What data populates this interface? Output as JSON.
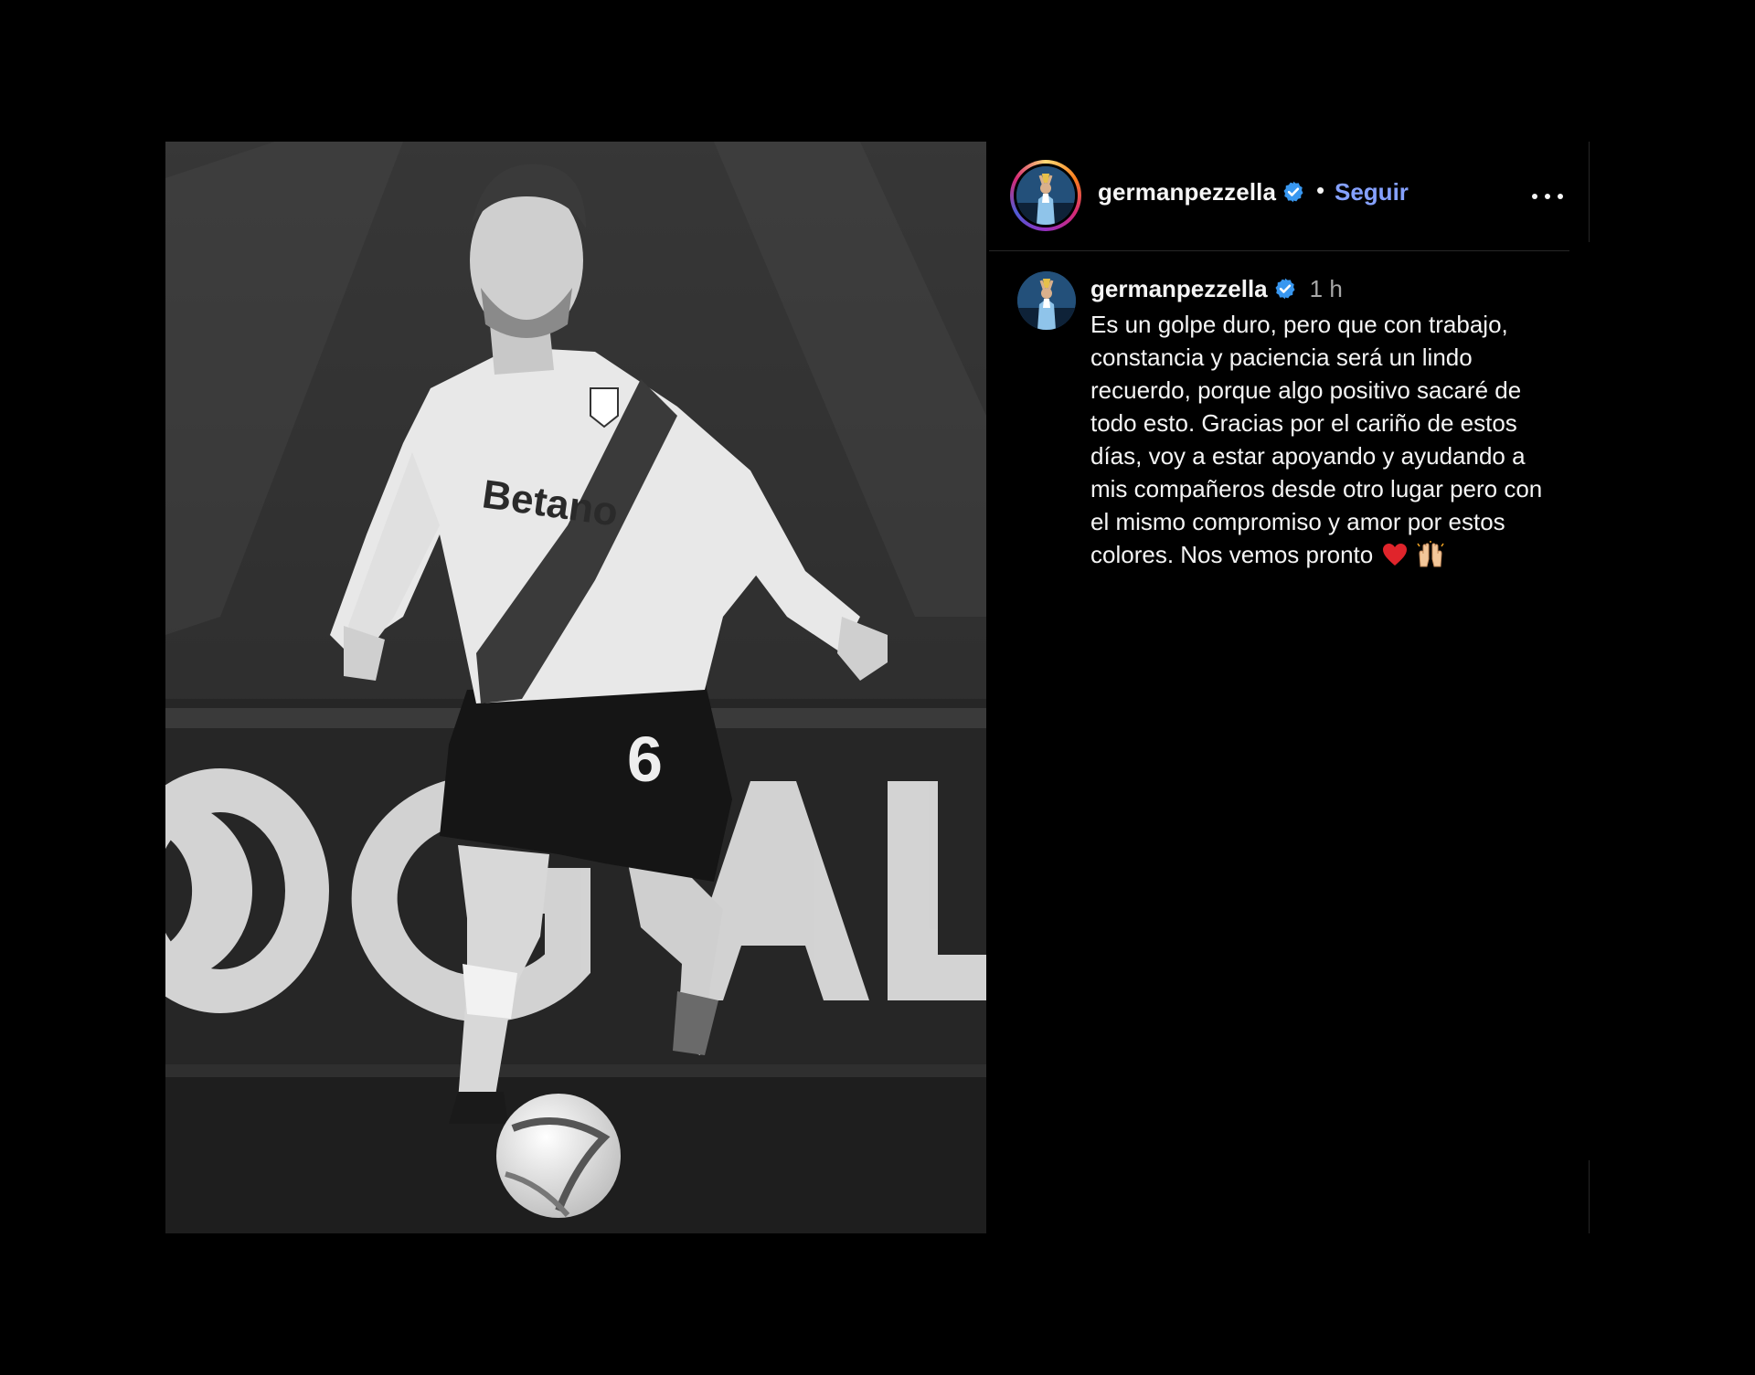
{
  "post": {
    "image_alt": "",
    "photo_colors": {
      "tone": "#2b2b2b",
      "shirt": "#e8e8e8",
      "sash": "#3a3a3a"
    }
  },
  "header": {
    "username": "germanpezzella",
    "separator": "•",
    "follow_label": "Seguir",
    "more_icon": "more-horizontal-icon",
    "verified_icon": "verified-badge-icon"
  },
  "caption": {
    "username": "germanpezzella",
    "time": "1 h",
    "text": "Es un golpe duro, pero que con trabajo, constancia y paciencia será un lindo recuerdo, porque algo positivo sacaré de todo esto. Gracias por el cariño de estos días, voy a estar apoyando y ayudando a mis compañeros desde otro lugar pero con el mismo compromiso y amor por estos colores. Nos vemos pronto",
    "emojis": [
      "red-heart-icon",
      "raising-hands-icon"
    ]
  },
  "colors": {
    "background": "#000000",
    "text": "#f5f5f5",
    "muted": "#a8a8a8",
    "link": "#85a1ff",
    "verified": "#3897f0",
    "divider": "#262626"
  }
}
